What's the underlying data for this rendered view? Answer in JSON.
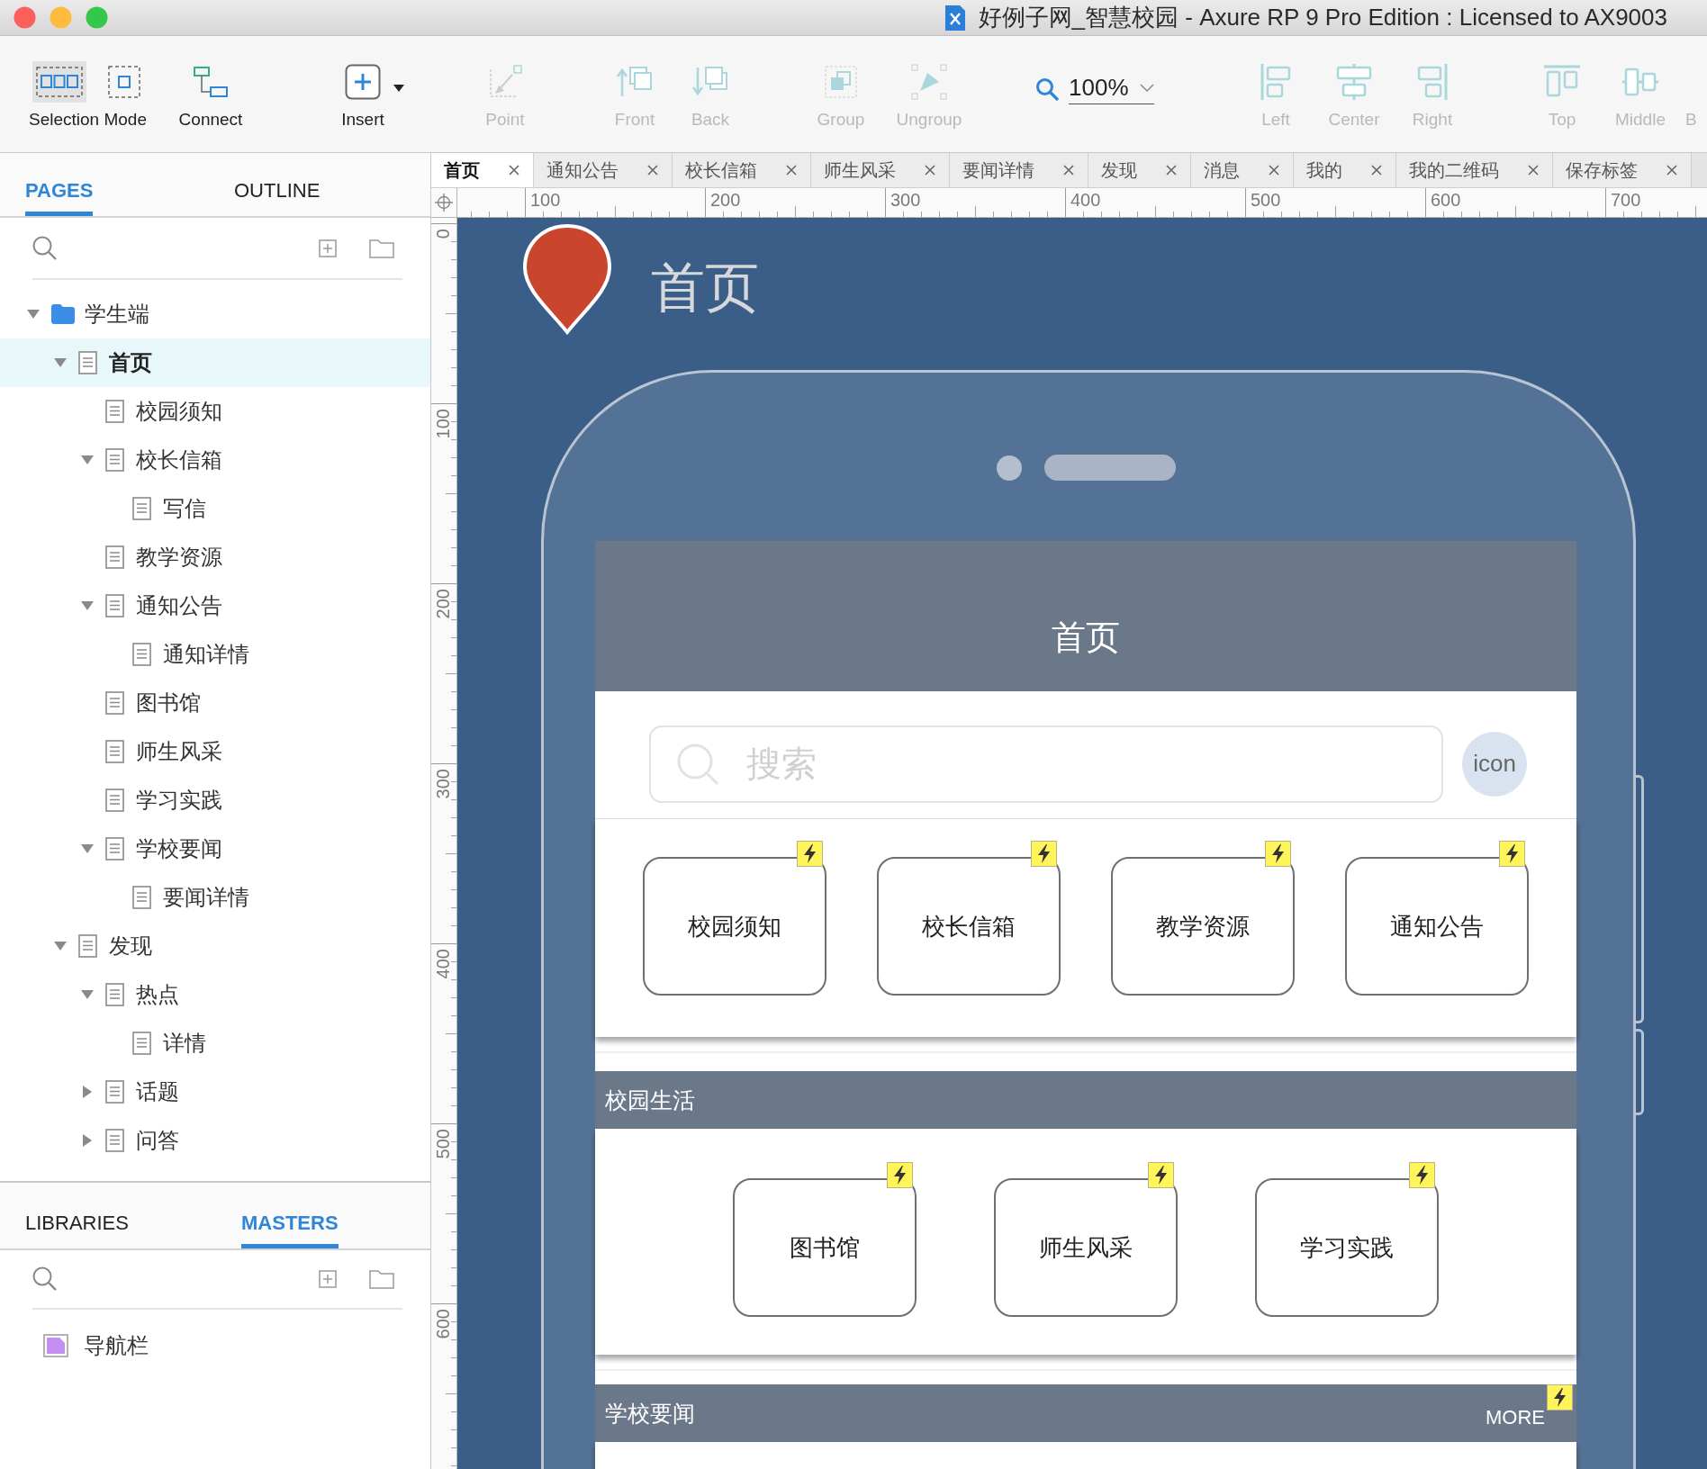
{
  "window": {
    "title": "好例子网_智慧校园 - Axure RP 9 Pro Edition : Licensed to AX9003"
  },
  "toolbar": {
    "tools": [
      {
        "kind": "selection_mode",
        "label": "Selection Mode",
        "disabled": false,
        "options": [
          {
            "kind": "intersect",
            "selected": true
          },
          {
            "kind": "contain",
            "selected": false
          }
        ]
      },
      {
        "kind": "connect",
        "label": "Connect",
        "disabled": false
      },
      {
        "kind": "insert",
        "label": "Insert",
        "disabled": false
      },
      {
        "kind": "point",
        "label": "Point",
        "disabled": true
      },
      {
        "kind": "front",
        "label": "Front",
        "disabled": true
      },
      {
        "kind": "back",
        "label": "Back",
        "disabled": true
      },
      {
        "kind": "group",
        "label": "Group",
        "disabled": true
      },
      {
        "kind": "ungroup",
        "label": "Ungroup",
        "disabled": true
      },
      {
        "kind": "zoom",
        "value": "100%"
      },
      {
        "kind": "left",
        "label": "Left",
        "disabled": true
      },
      {
        "kind": "center",
        "label": "Center",
        "disabled": true
      },
      {
        "kind": "right",
        "label": "Right",
        "disabled": true
      },
      {
        "kind": "top",
        "label": "Top",
        "disabled": true
      },
      {
        "kind": "middle",
        "label": "Middle",
        "disabled": true
      },
      {
        "kind": "bottom",
        "label": "B",
        "disabled": true
      }
    ]
  },
  "pages_panel": {
    "tabs": [
      {
        "label": "PAGES",
        "selected": true
      },
      {
        "label": "OUTLINE",
        "selected": false
      }
    ],
    "tree": [
      {
        "kind": "folder",
        "label": "学生端",
        "selected": false,
        "expanded": true,
        "children": [
          {
            "kind": "page",
            "label": "首页",
            "selected": true,
            "expanded": true,
            "children": [
              {
                "kind": "page",
                "label": "校园须知",
                "selected": false
              },
              {
                "kind": "page",
                "label": "校长信箱",
                "selected": false,
                "expanded": true,
                "children": [
                  {
                    "kind": "page",
                    "label": "写信",
                    "selected": false
                  }
                ]
              },
              {
                "kind": "page",
                "label": "教学资源",
                "selected": false
              },
              {
                "kind": "page",
                "label": "通知公告",
                "selected": false,
                "expanded": true,
                "children": [
                  {
                    "kind": "page",
                    "label": "通知详情",
                    "selected": false
                  }
                ]
              },
              {
                "kind": "page",
                "label": "图书馆",
                "selected": false
              },
              {
                "kind": "page",
                "label": "师生风采",
                "selected": false
              },
              {
                "kind": "page",
                "label": "学习实践",
                "selected": false
              },
              {
                "kind": "page",
                "label": "学校要闻",
                "selected": false,
                "expanded": true,
                "children": [
                  {
                    "kind": "page",
                    "label": "要闻详情",
                    "selected": false
                  }
                ]
              }
            ]
          },
          {
            "kind": "page",
            "label": "发现",
            "selected": false,
            "expanded": true,
            "children": [
              {
                "kind": "page",
                "label": "热点",
                "selected": false,
                "expanded": true,
                "children": [
                  {
                    "kind": "page",
                    "label": "详情",
                    "selected": false
                  }
                ]
              },
              {
                "kind": "page",
                "label": "话题",
                "selected": false,
                "expanded": false
              },
              {
                "kind": "page",
                "label": "问答",
                "selected": false,
                "expanded": false
              }
            ]
          }
        ]
      }
    ]
  },
  "masters_panel": {
    "tabs": [
      {
        "label": "LIBRARIES",
        "selected": false
      },
      {
        "label": "MASTERS",
        "selected": true
      }
    ],
    "items": [
      {
        "kind": "master",
        "label": "导航栏"
      }
    ]
  },
  "document_tabs": [
    {
      "label": "首页",
      "selected": true
    },
    {
      "label": "通知公告",
      "selected": false
    },
    {
      "label": "校长信箱",
      "selected": false
    },
    {
      "label": "师生风采",
      "selected": false
    },
    {
      "label": "要闻详情",
      "selected": false
    },
    {
      "label": "发现",
      "selected": false
    },
    {
      "label": "消息",
      "selected": false
    },
    {
      "label": "我的",
      "selected": false
    },
    {
      "label": "我的二维码",
      "selected": false
    },
    {
      "label": "保存标签",
      "selected": false
    }
  ],
  "rulers": {
    "horizontal": [
      "100",
      "200",
      "300",
      "400",
      "500",
      "600",
      "700"
    ],
    "vertical": [
      "0",
      "100",
      "200",
      "300",
      "400",
      "500",
      "600"
    ]
  },
  "canvas": {
    "title": "首页",
    "app": {
      "title": "首页",
      "search": {
        "placeholder": "搜索"
      },
      "circle_label": "icon",
      "quick_links": [
        "校园须知",
        "校长信箱",
        "教学资源",
        "通知公告"
      ],
      "sections": [
        {
          "title": "校园生活",
          "items": [
            "图书馆",
            "师生风采",
            "学习实践"
          ]
        },
        {
          "title": "学校要闻",
          "more": "MORE"
        }
      ]
    }
  }
}
